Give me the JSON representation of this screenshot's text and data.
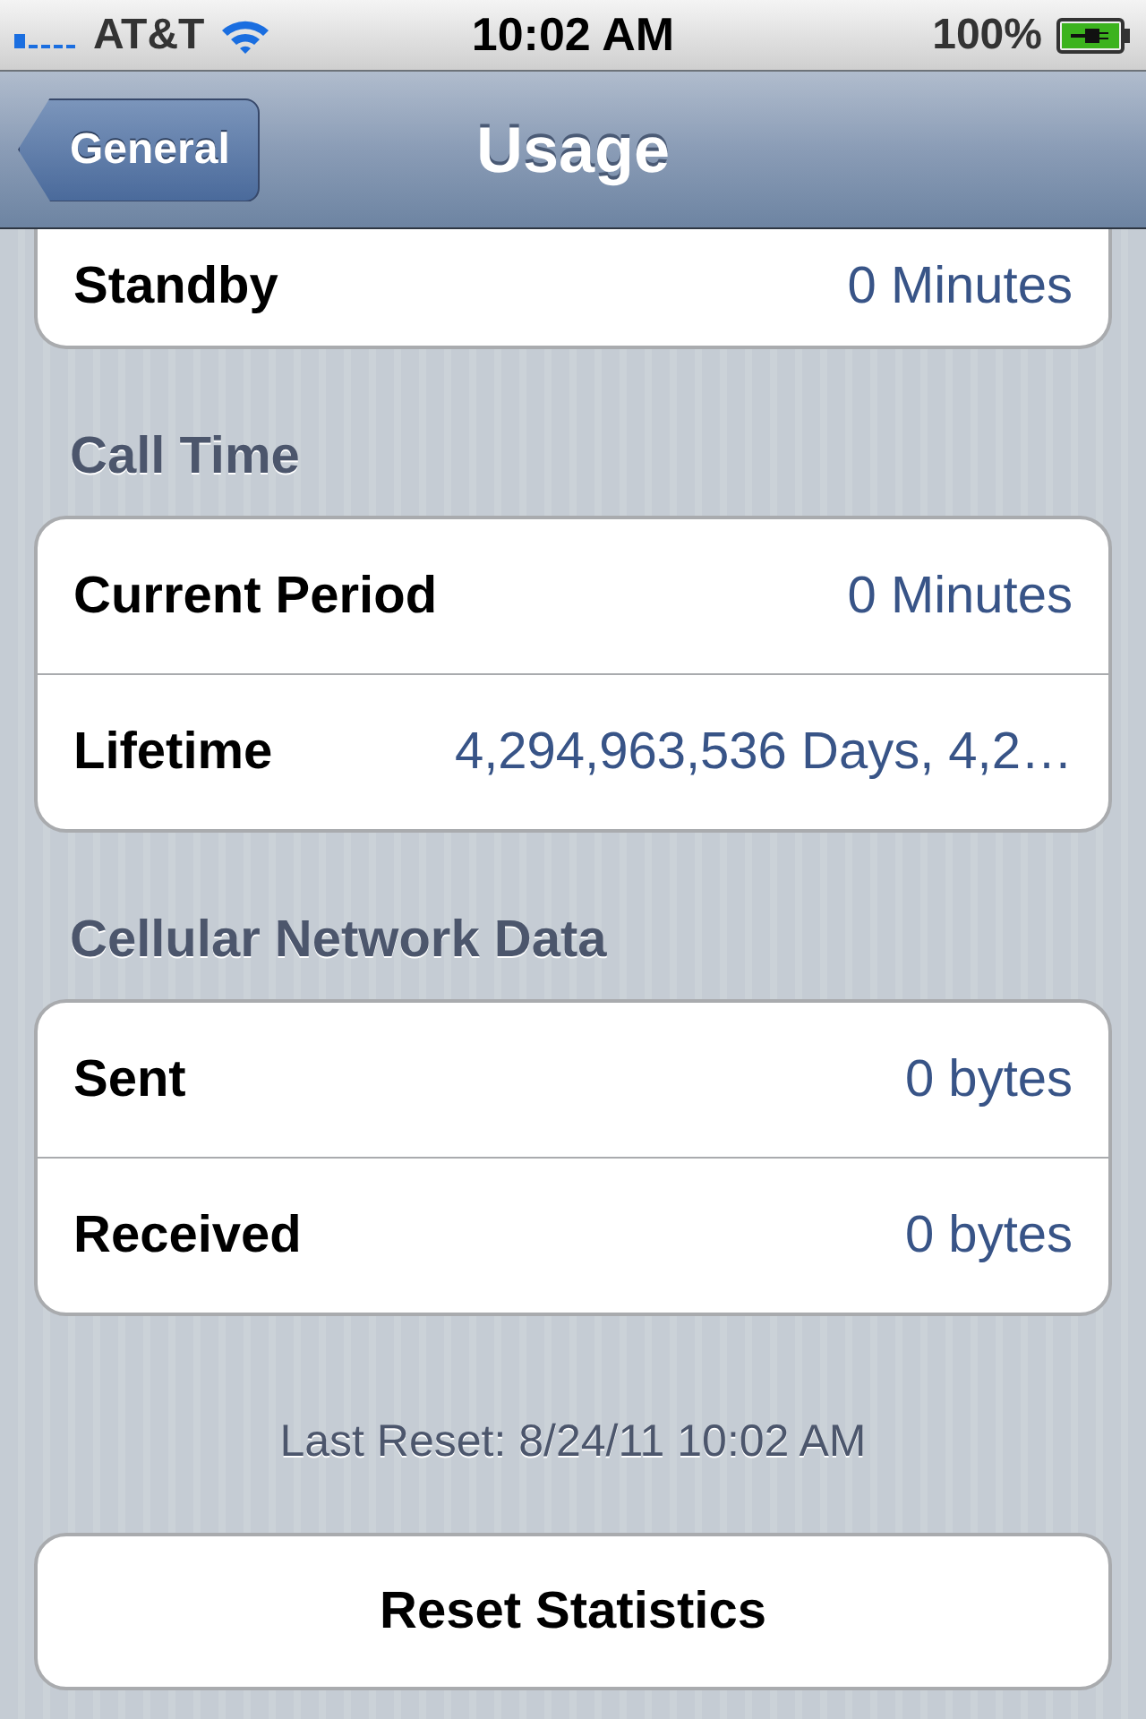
{
  "status_bar": {
    "carrier": "AT&T",
    "time": "10:02 AM",
    "battery": "100%"
  },
  "nav_bar": {
    "back_button": "General",
    "title": "Usage"
  },
  "sections": [
    {
      "rows": [
        {
          "label": "Standby",
          "value": "0 Minutes"
        }
      ]
    },
    {
      "header": "Call Time",
      "rows": [
        {
          "label": "Current Period",
          "value": "0 Minutes"
        },
        {
          "label": "Lifetime",
          "value": "4,294,963,536 Days, 4,2…"
        }
      ]
    },
    {
      "header": "Cellular Network Data",
      "rows": [
        {
          "label": "Sent",
          "value": "0 bytes"
        },
        {
          "label": "Received",
          "value": "0 bytes"
        }
      ]
    }
  ],
  "footer": "Last Reset: 8/24/11 10:02 AM",
  "reset_button": "Reset Statistics"
}
